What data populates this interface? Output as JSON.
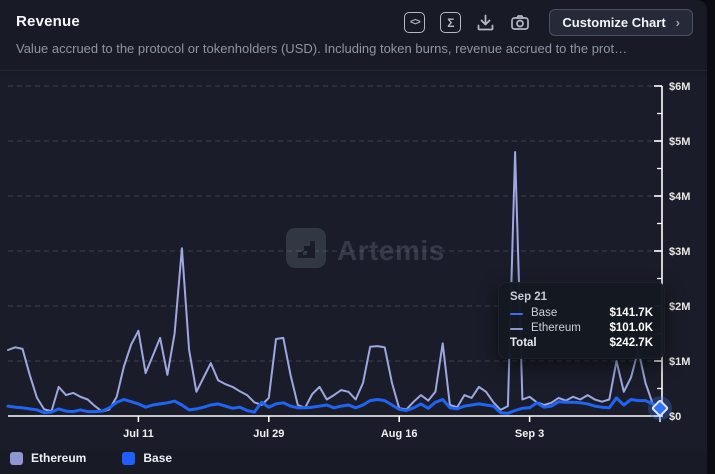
{
  "header": {
    "title": "Revenue",
    "description": "Value accrued to the protocol or tokenholders (USD). Including token burns, revenue accrued to the prot…",
    "icons": [
      {
        "name": "embed-code-icon",
        "glyph": "<>"
      },
      {
        "name": "sigma-icon",
        "glyph": "Σ"
      },
      {
        "name": "download-icon"
      },
      {
        "name": "camera-icon"
      }
    ],
    "customize_button": {
      "label": "Customize Chart",
      "chevron": "›"
    }
  },
  "watermark": {
    "text": "Artemis"
  },
  "tooltip": {
    "date": "Sep 21",
    "rows": [
      {
        "label": "Base",
        "value": "$141.7K",
        "color": "#3d6df2"
      },
      {
        "label": "Ethereum",
        "value": "$101.0K",
        "color": "#8b94cd"
      }
    ],
    "total_label": "Total",
    "total_value": "$242.7K"
  },
  "legend": [
    {
      "label": "Ethereum",
      "color": "#8e97d3"
    },
    {
      "label": "Base",
      "color": "#1f5eff"
    }
  ],
  "chart_data": {
    "type": "line",
    "title": "Revenue",
    "unit": "USD",
    "grid": "dashed-horizontal",
    "legend_position": "bottom-left",
    "y_axis": {
      "side": "right",
      "tick_labels": [
        "$0",
        "$1M",
        "$2M",
        "$3M",
        "$4M",
        "$5M",
        "$6M"
      ],
      "ylim_musd": [
        0,
        6
      ]
    },
    "x_axis": {
      "tick_labels": [
        "Jul 11",
        "Jul 29",
        "Aug 16",
        "Sep 3"
      ],
      "tick_indices": [
        18,
        36,
        54,
        72
      ],
      "end_tick_index": 90,
      "hovered_point_label": "Sep 21",
      "hovered_point_index": 90
    },
    "series": [
      {
        "name": "Ethereum",
        "color": "#9da7e0",
        "values_musd": [
          1.2,
          1.25,
          1.22,
          0.75,
          0.33,
          0.12,
          0.09,
          0.53,
          0.38,
          0.42,
          0.35,
          0.3,
          0.18,
          0.08,
          0.12,
          0.35,
          0.9,
          1.3,
          1.55,
          0.78,
          1.1,
          1.42,
          0.75,
          1.5,
          3.05,
          1.2,
          0.44,
          0.7,
          0.96,
          0.65,
          0.58,
          0.53,
          0.45,
          0.38,
          0.25,
          0.2,
          0.33,
          1.4,
          1.42,
          0.75,
          0.2,
          0.15,
          0.4,
          0.53,
          0.3,
          0.38,
          0.47,
          0.44,
          0.3,
          0.6,
          1.26,
          1.27,
          1.25,
          0.6,
          0.14,
          0.12,
          0.26,
          0.38,
          0.28,
          0.44,
          1.32,
          0.2,
          0.16,
          0.38,
          0.33,
          0.53,
          0.44,
          0.25,
          0.11,
          0.18,
          4.8,
          0.3,
          0.35,
          0.25,
          0.2,
          0.24,
          0.33,
          0.28,
          0.35,
          0.3,
          0.38,
          0.3,
          0.26,
          0.3,
          1.0,
          0.44,
          0.7,
          1.2,
          0.6,
          0.22,
          0.101
        ]
      },
      {
        "name": "Base",
        "color": "#2064f4",
        "values_musd": [
          0.18,
          0.16,
          0.15,
          0.13,
          0.11,
          0.06,
          0.07,
          0.13,
          0.09,
          0.08,
          0.11,
          0.08,
          0.08,
          0.09,
          0.15,
          0.25,
          0.3,
          0.26,
          0.22,
          0.16,
          0.2,
          0.22,
          0.24,
          0.27,
          0.2,
          0.11,
          0.13,
          0.16,
          0.2,
          0.22,
          0.18,
          0.14,
          0.16,
          0.1,
          0.07,
          0.25,
          0.16,
          0.22,
          0.24,
          0.18,
          0.15,
          0.15,
          0.16,
          0.18,
          0.2,
          0.15,
          0.18,
          0.2,
          0.15,
          0.2,
          0.28,
          0.3,
          0.28,
          0.2,
          0.12,
          0.1,
          0.15,
          0.22,
          0.14,
          0.25,
          0.3,
          0.15,
          0.13,
          0.18,
          0.2,
          0.22,
          0.2,
          0.18,
          0.06,
          0.05,
          0.1,
          0.14,
          0.15,
          0.24,
          0.16,
          0.18,
          0.26,
          0.25,
          0.25,
          0.24,
          0.22,
          0.18,
          0.16,
          0.15,
          0.33,
          0.2,
          0.3,
          0.28,
          0.28,
          0.22,
          0.1417
        ]
      }
    ]
  }
}
